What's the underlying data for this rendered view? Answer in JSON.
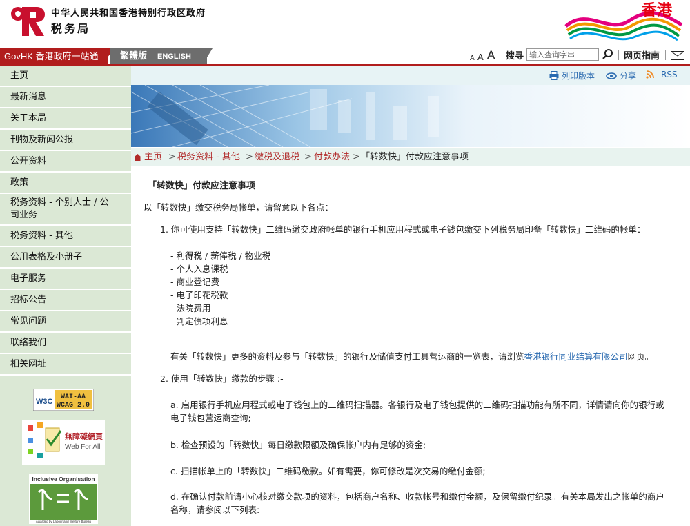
{
  "header": {
    "dept_full_cn": "中华人民共和国香港特别行政区政府",
    "dept_name": "税务局",
    "brand": "香港"
  },
  "topbar": {
    "govhk": "GovHK 香港政府一站通",
    "lang_traditional": "繁體版",
    "lang_english": "ENGLISH",
    "font_sizes": [
      "A",
      "A",
      "A"
    ],
    "search_label": "搜寻",
    "search_placeholder": "输入查询字串",
    "guide": "网页指南"
  },
  "sidebar": {
    "items": [
      {
        "label": "主页"
      },
      {
        "label": "最新消息"
      },
      {
        "label": "关于本局"
      },
      {
        "label": "刊物及新闻公报"
      },
      {
        "label": "公开资料"
      },
      {
        "label": "政策"
      },
      {
        "label": "税务资料 - 个别人士 / 公司业务"
      },
      {
        "label": "税务资料 - 其他"
      },
      {
        "label": "公用表格及小册子"
      },
      {
        "label": "电子服务"
      },
      {
        "label": "招标公告"
      },
      {
        "label": "常见问题"
      },
      {
        "label": "联络我们"
      },
      {
        "label": "相关网址"
      }
    ],
    "badges": {
      "w3c_left": "W3C",
      "w3c_line1": "WAI-AA",
      "w3c_line2": "WCAG 2.0",
      "web_for_all_cn": "無障礙網頁",
      "web_for_all_en": "Web For All",
      "inclusive_title": "Inclusive Organisation",
      "inclusive_caption": "Awarded by Labour and Welfare Bureau"
    }
  },
  "utilities": {
    "print": "列印版本",
    "share": "分享",
    "rss": "RSS"
  },
  "breadcrumb": {
    "items": [
      "主页",
      "税务资料 - 其他",
      "缴税及退税",
      "付款办法"
    ],
    "current": "「转数快」付款应注意事项"
  },
  "article": {
    "title": "「转数快」付款应注意事项",
    "intro": "以「转数快」缴交税务局帐单，请留意以下各点：",
    "point1": "1. 你可使用支持「转数快」二维码缴交政府帐单的银行手机应用程式或电子钱包缴交下列税务局印备「转数快」二维码的帐单：",
    "bills": [
      "- 利得税 / 薪俸税 / 物业税",
      "- 个人入息课税",
      "- 商业登记费",
      "- 电子印花税款",
      "- 法院费用",
      "- 判定债项利息"
    ],
    "more_info_pre": "有关「转数快」更多的资料及参与「转数快」的银行及储值支付工具营运商的一览表，请浏览",
    "more_info_link": "香港银行同业结算有限公司",
    "more_info_post": "网页。",
    "point2": "2. 使用「转数快」缴款的步骤 :-",
    "step_a_1": "a. 启用银行手机应用程式或电子钱包上的二维码扫描器。各银行及电子钱包提供的二维码扫描功能有所不同，详情请向你的银行或",
    "step_a_2": "电子钱包营运商查询;",
    "step_b": "b. 检查预设的「转数快」每日缴款限额及确保帐户内有足够的资金;",
    "step_c": "c. 扫描帐单上的「转数快」二维码缴款。如有需要，你可修改是次交易的缴付金额;",
    "step_d_1": "d. 在确认付款前请小心核对缴交款项的资料，包括商户名称、收款帐号和缴付金额，及保留缴付纪录。有关本局发出之帐单的商户",
    "step_d_2": "名称，请参阅以下列表:"
  },
  "colors": {
    "brand_red": "#b11d1d",
    "sidebar_bg": "#dbe8d5",
    "link_blue": "#2a6ab0",
    "crumb_red": "#b12a2a"
  }
}
